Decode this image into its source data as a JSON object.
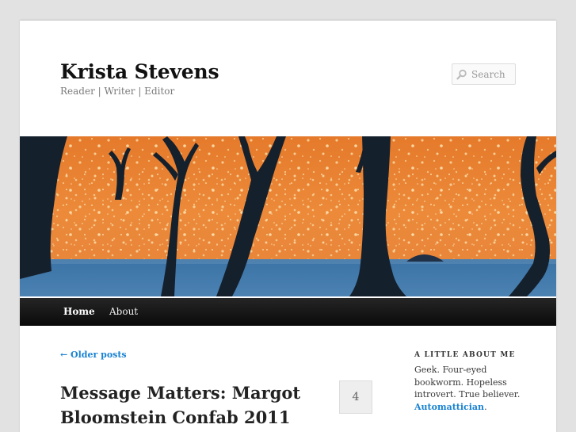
{
  "site": {
    "title": "Krista Stevens",
    "description": "Reader | Writer | Editor"
  },
  "search": {
    "placeholder": "Search",
    "icon": "search-icon"
  },
  "nav": {
    "items": [
      {
        "label": "Home",
        "current": true
      },
      {
        "label": "About",
        "current": false
      }
    ]
  },
  "content": {
    "older_posts_label": "← Older posts",
    "post_title": "Message Matters: Margot Bloomstein Confab 2011",
    "comment_count": "4"
  },
  "sidebar": {
    "widget_title": "A Little About Me",
    "widget_text": "Geek. Four-eyed bookworm. Hopeless introvert. True believer.",
    "widget_link": "Automattician",
    "widget_suffix": "."
  },
  "colors": {
    "link": "#1982d1",
    "nav_background": "#252525",
    "page_background": "#e2e2e2",
    "sky_orange": "#e8792c",
    "ground_blue": "#3d6f9d"
  }
}
